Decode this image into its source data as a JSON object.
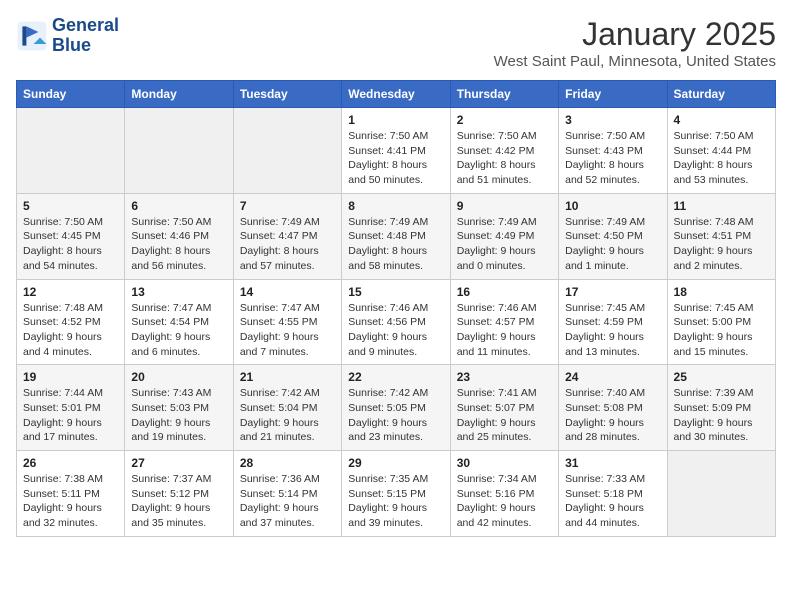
{
  "header": {
    "logo_line1": "General",
    "logo_line2": "Blue",
    "month_title": "January 2025",
    "location": "West Saint Paul, Minnesota, United States"
  },
  "days_of_week": [
    "Sunday",
    "Monday",
    "Tuesday",
    "Wednesday",
    "Thursday",
    "Friday",
    "Saturday"
  ],
  "weeks": [
    [
      {
        "day": "",
        "info": ""
      },
      {
        "day": "",
        "info": ""
      },
      {
        "day": "",
        "info": ""
      },
      {
        "day": "1",
        "info": "Sunrise: 7:50 AM\nSunset: 4:41 PM\nDaylight: 8 hours\nand 50 minutes."
      },
      {
        "day": "2",
        "info": "Sunrise: 7:50 AM\nSunset: 4:42 PM\nDaylight: 8 hours\nand 51 minutes."
      },
      {
        "day": "3",
        "info": "Sunrise: 7:50 AM\nSunset: 4:43 PM\nDaylight: 8 hours\nand 52 minutes."
      },
      {
        "day": "4",
        "info": "Sunrise: 7:50 AM\nSunset: 4:44 PM\nDaylight: 8 hours\nand 53 minutes."
      }
    ],
    [
      {
        "day": "5",
        "info": "Sunrise: 7:50 AM\nSunset: 4:45 PM\nDaylight: 8 hours\nand 54 minutes."
      },
      {
        "day": "6",
        "info": "Sunrise: 7:50 AM\nSunset: 4:46 PM\nDaylight: 8 hours\nand 56 minutes."
      },
      {
        "day": "7",
        "info": "Sunrise: 7:49 AM\nSunset: 4:47 PM\nDaylight: 8 hours\nand 57 minutes."
      },
      {
        "day": "8",
        "info": "Sunrise: 7:49 AM\nSunset: 4:48 PM\nDaylight: 8 hours\nand 58 minutes."
      },
      {
        "day": "9",
        "info": "Sunrise: 7:49 AM\nSunset: 4:49 PM\nDaylight: 9 hours\nand 0 minutes."
      },
      {
        "day": "10",
        "info": "Sunrise: 7:49 AM\nSunset: 4:50 PM\nDaylight: 9 hours\nand 1 minute."
      },
      {
        "day": "11",
        "info": "Sunrise: 7:48 AM\nSunset: 4:51 PM\nDaylight: 9 hours\nand 2 minutes."
      }
    ],
    [
      {
        "day": "12",
        "info": "Sunrise: 7:48 AM\nSunset: 4:52 PM\nDaylight: 9 hours\nand 4 minutes."
      },
      {
        "day": "13",
        "info": "Sunrise: 7:47 AM\nSunset: 4:54 PM\nDaylight: 9 hours\nand 6 minutes."
      },
      {
        "day": "14",
        "info": "Sunrise: 7:47 AM\nSunset: 4:55 PM\nDaylight: 9 hours\nand 7 minutes."
      },
      {
        "day": "15",
        "info": "Sunrise: 7:46 AM\nSunset: 4:56 PM\nDaylight: 9 hours\nand 9 minutes."
      },
      {
        "day": "16",
        "info": "Sunrise: 7:46 AM\nSunset: 4:57 PM\nDaylight: 9 hours\nand 11 minutes."
      },
      {
        "day": "17",
        "info": "Sunrise: 7:45 AM\nSunset: 4:59 PM\nDaylight: 9 hours\nand 13 minutes."
      },
      {
        "day": "18",
        "info": "Sunrise: 7:45 AM\nSunset: 5:00 PM\nDaylight: 9 hours\nand 15 minutes."
      }
    ],
    [
      {
        "day": "19",
        "info": "Sunrise: 7:44 AM\nSunset: 5:01 PM\nDaylight: 9 hours\nand 17 minutes."
      },
      {
        "day": "20",
        "info": "Sunrise: 7:43 AM\nSunset: 5:03 PM\nDaylight: 9 hours\nand 19 minutes."
      },
      {
        "day": "21",
        "info": "Sunrise: 7:42 AM\nSunset: 5:04 PM\nDaylight: 9 hours\nand 21 minutes."
      },
      {
        "day": "22",
        "info": "Sunrise: 7:42 AM\nSunset: 5:05 PM\nDaylight: 9 hours\nand 23 minutes."
      },
      {
        "day": "23",
        "info": "Sunrise: 7:41 AM\nSunset: 5:07 PM\nDaylight: 9 hours\nand 25 minutes."
      },
      {
        "day": "24",
        "info": "Sunrise: 7:40 AM\nSunset: 5:08 PM\nDaylight: 9 hours\nand 28 minutes."
      },
      {
        "day": "25",
        "info": "Sunrise: 7:39 AM\nSunset: 5:09 PM\nDaylight: 9 hours\nand 30 minutes."
      }
    ],
    [
      {
        "day": "26",
        "info": "Sunrise: 7:38 AM\nSunset: 5:11 PM\nDaylight: 9 hours\nand 32 minutes."
      },
      {
        "day": "27",
        "info": "Sunrise: 7:37 AM\nSunset: 5:12 PM\nDaylight: 9 hours\nand 35 minutes."
      },
      {
        "day": "28",
        "info": "Sunrise: 7:36 AM\nSunset: 5:14 PM\nDaylight: 9 hours\nand 37 minutes."
      },
      {
        "day": "29",
        "info": "Sunrise: 7:35 AM\nSunset: 5:15 PM\nDaylight: 9 hours\nand 39 minutes."
      },
      {
        "day": "30",
        "info": "Sunrise: 7:34 AM\nSunset: 5:16 PM\nDaylight: 9 hours\nand 42 minutes."
      },
      {
        "day": "31",
        "info": "Sunrise: 7:33 AM\nSunset: 5:18 PM\nDaylight: 9 hours\nand 44 minutes."
      },
      {
        "day": "",
        "info": ""
      }
    ]
  ]
}
